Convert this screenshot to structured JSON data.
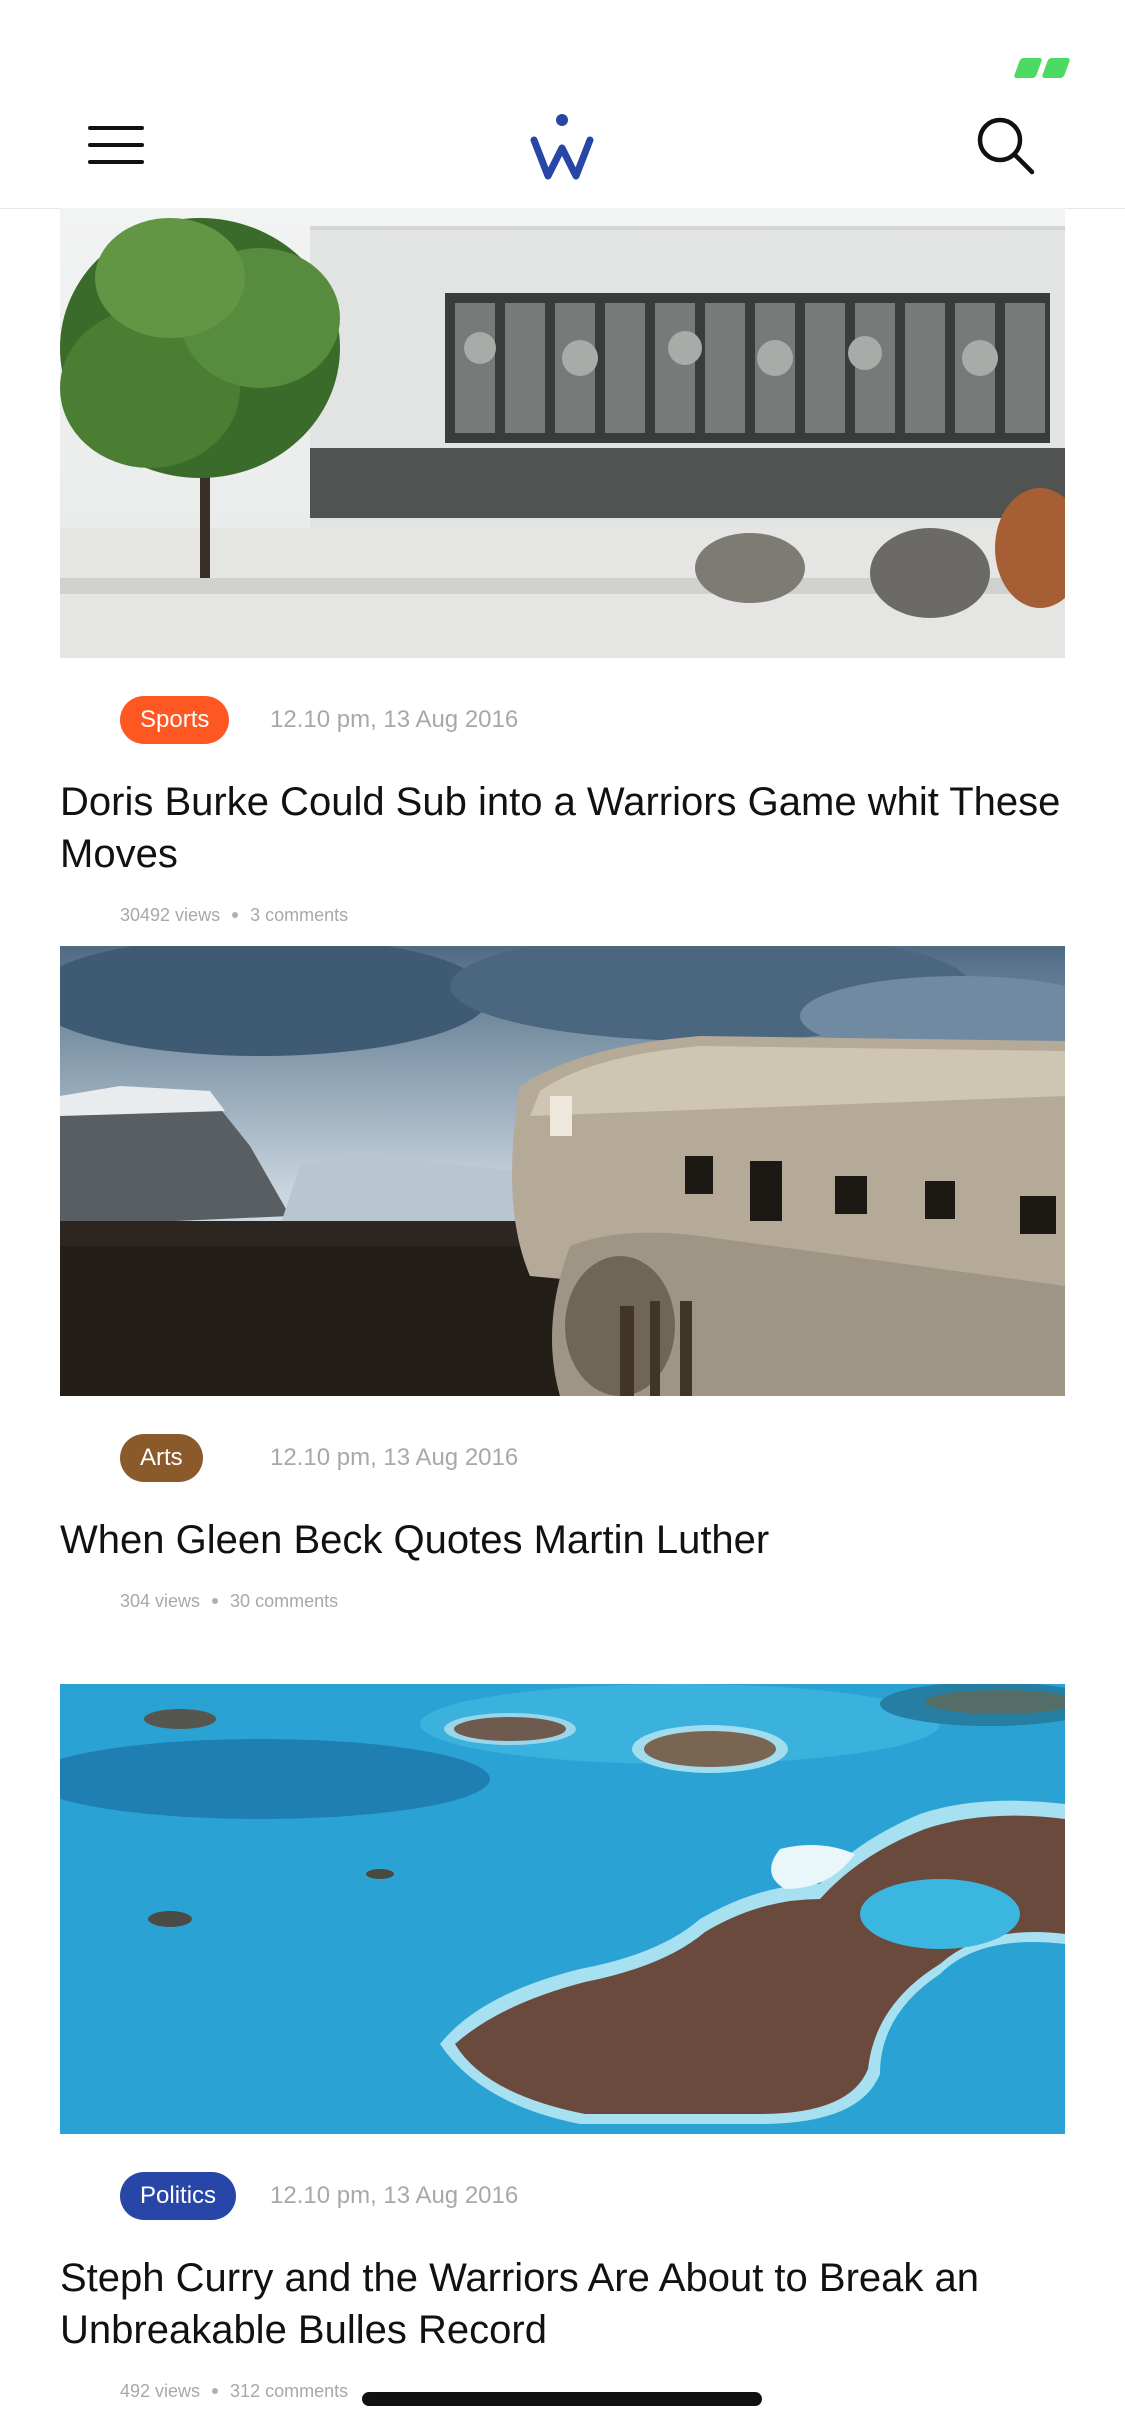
{
  "status_bar": {
    "battery_icon": "battery-charging-icon",
    "battery_color": "#4cd964"
  },
  "header": {
    "menu_icon": "hamburger-menu-icon",
    "logo_icon": "w-logo-icon",
    "logo_color": "#2746a8",
    "search_icon": "search-icon"
  },
  "articles": [
    {
      "category": "Sports",
      "category_color": "#ff5722",
      "timestamp": "12.10 pm, 13 Aug 2016",
      "title": "Doris Burke Could Sub  into a Warriors Game whit These Moves",
      "views": "30492 views",
      "comments": "3 comments",
      "image": "museum-building-photo"
    },
    {
      "category": "Arts",
      "category_color": "#8b5a2b",
      "timestamp": "12.10 pm, 13 Aug 2016",
      "title": "When Gleen Beck Quotes Martin Luther",
      "views": "304 views",
      "comments": "30 comments",
      "image": "plane-wreck-photo"
    },
    {
      "category": "Politics",
      "category_color": "#2746a8",
      "timestamp": "12.10 pm, 13 Aug 2016",
      "title": "Steph Curry and the Warriors Are About to Break an Unbreakable Bulles Record",
      "views": "492 views",
      "comments": "312 comments",
      "image": "islands-aerial-photo"
    }
  ]
}
